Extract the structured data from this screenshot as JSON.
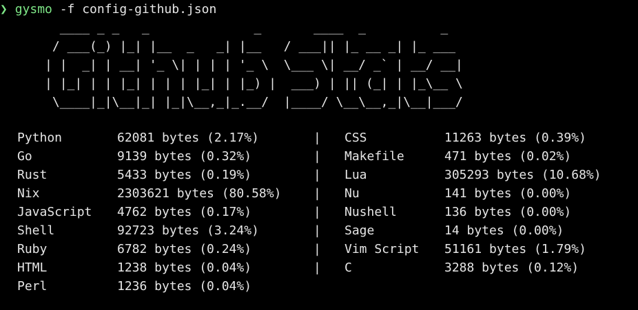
{
  "prompt": {
    "symbol": "❯",
    "command": "gysmo",
    "args": " -f config-github.json"
  },
  "ascii_art": "        ____ _ _   _              _       ____  _          _\n       / ___(_) |_| |__  _   _| |__   / ___|| |_ __ _| |_ ___\n      | |  _| | __| '_ \\| | | | '_ \\  \\___ \\| __/ _` | __/ __|\n      | |_| | | |_| | | | |_| | |_) |  ___) | || (_| | |_\\__ \\\n       \\____|_|\\__|_| |_|\\__,_|_.__/  |____/ \\__\\__,_|\\__|___/",
  "stats": [
    {
      "lang": "Python",
      "value": "62081 bytes (2.17%)",
      "sep": "|",
      "lang2": "CSS",
      "value2": "11263 bytes (0.39%)"
    },
    {
      "lang": "Go",
      "value": "9139 bytes (0.32%)",
      "sep": "|",
      "lang2": "Makefile",
      "value2": "471 bytes (0.02%)"
    },
    {
      "lang": "Rust",
      "value": "5433 bytes (0.19%)",
      "sep": "|",
      "lang2": "Lua",
      "value2": "305293 bytes (10.68%)"
    },
    {
      "lang": "Nix",
      "value": "2303621 bytes (80.58%)",
      "sep": "|",
      "lang2": "Nu",
      "value2": "141 bytes (0.00%)"
    },
    {
      "lang": "JavaScript",
      "value": "4762 bytes (0.17%)",
      "sep": "|",
      "lang2": "Nushell",
      "value2": "136 bytes (0.00%)"
    },
    {
      "lang": "Shell",
      "value": "92723 bytes (3.24%)",
      "sep": "|",
      "lang2": "Sage",
      "value2": "14 bytes (0.00%)"
    },
    {
      "lang": "Ruby",
      "value": "6782 bytes (0.24%)",
      "sep": "|",
      "lang2": "Vim Script",
      "value2": "51161 bytes (1.79%)"
    },
    {
      "lang": "HTML",
      "value": "1238 bytes (0.04%)",
      "sep": "|",
      "lang2": "C",
      "value2": "3288 bytes (0.12%)"
    },
    {
      "lang": "Perl",
      "value": "1236 bytes (0.04%)",
      "sep": "",
      "lang2": "",
      "value2": ""
    }
  ],
  "colors": {
    "background": "#000000",
    "text": "#e6e6e6",
    "prompt_green": "#7ee787"
  }
}
